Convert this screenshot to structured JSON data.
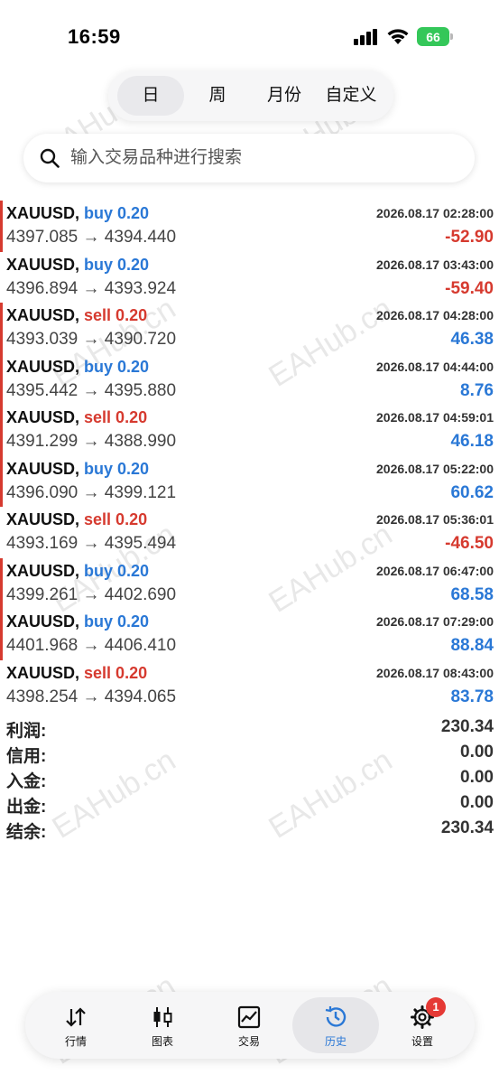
{
  "status_bar": {
    "time": "16:59",
    "battery": "66",
    "icons": [
      "signal-icon",
      "wifi-icon",
      "battery-icon"
    ]
  },
  "period_tabs": [
    {
      "label": "日",
      "active": true
    },
    {
      "label": "周",
      "active": false
    },
    {
      "label": "月份",
      "active": false
    },
    {
      "label": "自定义",
      "active": false
    }
  ],
  "search": {
    "placeholder": "输入交易品种进行搜索",
    "value": ""
  },
  "trades": [
    {
      "symbol": "XAUUSD,",
      "side": "buy 0.20",
      "type": "buy",
      "time": "2026.08.17 02:28:00",
      "prices": "4397.085 → 4394.440",
      "profit": "-52.90",
      "marker": true
    },
    {
      "symbol": "XAUUSD,",
      "side": "buy 0.20",
      "type": "buy",
      "time": "2026.08.17 03:43:00",
      "prices": "4396.894 → 4393.924",
      "profit": "-59.40",
      "marker": false
    },
    {
      "symbol": "XAUUSD,",
      "side": "sell 0.20",
      "type": "sell",
      "time": "2026.08.17 04:28:00",
      "prices": "4393.039 → 4390.720",
      "profit": "46.38",
      "marker": true
    },
    {
      "symbol": "XAUUSD,",
      "side": "buy 0.20",
      "type": "buy",
      "time": "2026.08.17 04:44:00",
      "prices": "4395.442 → 4395.880",
      "profit": "8.76",
      "marker": true
    },
    {
      "symbol": "XAUUSD,",
      "side": "sell 0.20",
      "type": "sell",
      "time": "2026.08.17 04:59:01",
      "prices": "4391.299 → 4388.990",
      "profit": "46.18",
      "marker": true
    },
    {
      "symbol": "XAUUSD,",
      "side": "buy 0.20",
      "type": "buy",
      "time": "2026.08.17 05:22:00",
      "prices": "4396.090 → 4399.121",
      "profit": "60.62",
      "marker": true
    },
    {
      "symbol": "XAUUSD,",
      "side": "sell 0.20",
      "type": "sell",
      "time": "2026.08.17 05:36:01",
      "prices": "4393.169 → 4395.494",
      "profit": "-46.50",
      "marker": false
    },
    {
      "symbol": "XAUUSD,",
      "side": "buy 0.20",
      "type": "buy",
      "time": "2026.08.17 06:47:00",
      "prices": "4399.261 → 4402.690",
      "profit": "68.58",
      "marker": true
    },
    {
      "symbol": "XAUUSD,",
      "side": "buy 0.20",
      "type": "buy",
      "time": "2026.08.17 07:29:00",
      "prices": "4401.968 → 4406.410",
      "profit": "88.84",
      "marker": true
    },
    {
      "symbol": "XAUUSD,",
      "side": "sell 0.20",
      "type": "sell",
      "time": "2026.08.17 08:43:00",
      "prices": "4398.254 → 4394.065",
      "profit": "83.78",
      "marker": false
    }
  ],
  "summary": [
    {
      "label": "利润:",
      "value": "230.34"
    },
    {
      "label": "信用:",
      "value": "0.00"
    },
    {
      "label": "入金:",
      "value": "0.00"
    },
    {
      "label": "出金:",
      "value": "0.00"
    },
    {
      "label": "结余:",
      "value": "230.34"
    }
  ],
  "watermark": "EAHub.cn",
  "colors": {
    "buy": "#2a78d6",
    "sell": "#d63a2f",
    "marker": "#d63a2f",
    "active_nav": "#2a78d6"
  },
  "bottom_nav": [
    {
      "label": "行情",
      "icon": "quotes-icon",
      "active": false
    },
    {
      "label": "图表",
      "icon": "chart-icon",
      "active": false
    },
    {
      "label": "交易",
      "icon": "trade-icon",
      "active": false
    },
    {
      "label": "历史",
      "icon": "history-icon",
      "active": true
    },
    {
      "label": "设置",
      "icon": "settings-icon",
      "active": false,
      "badge": "1"
    }
  ]
}
